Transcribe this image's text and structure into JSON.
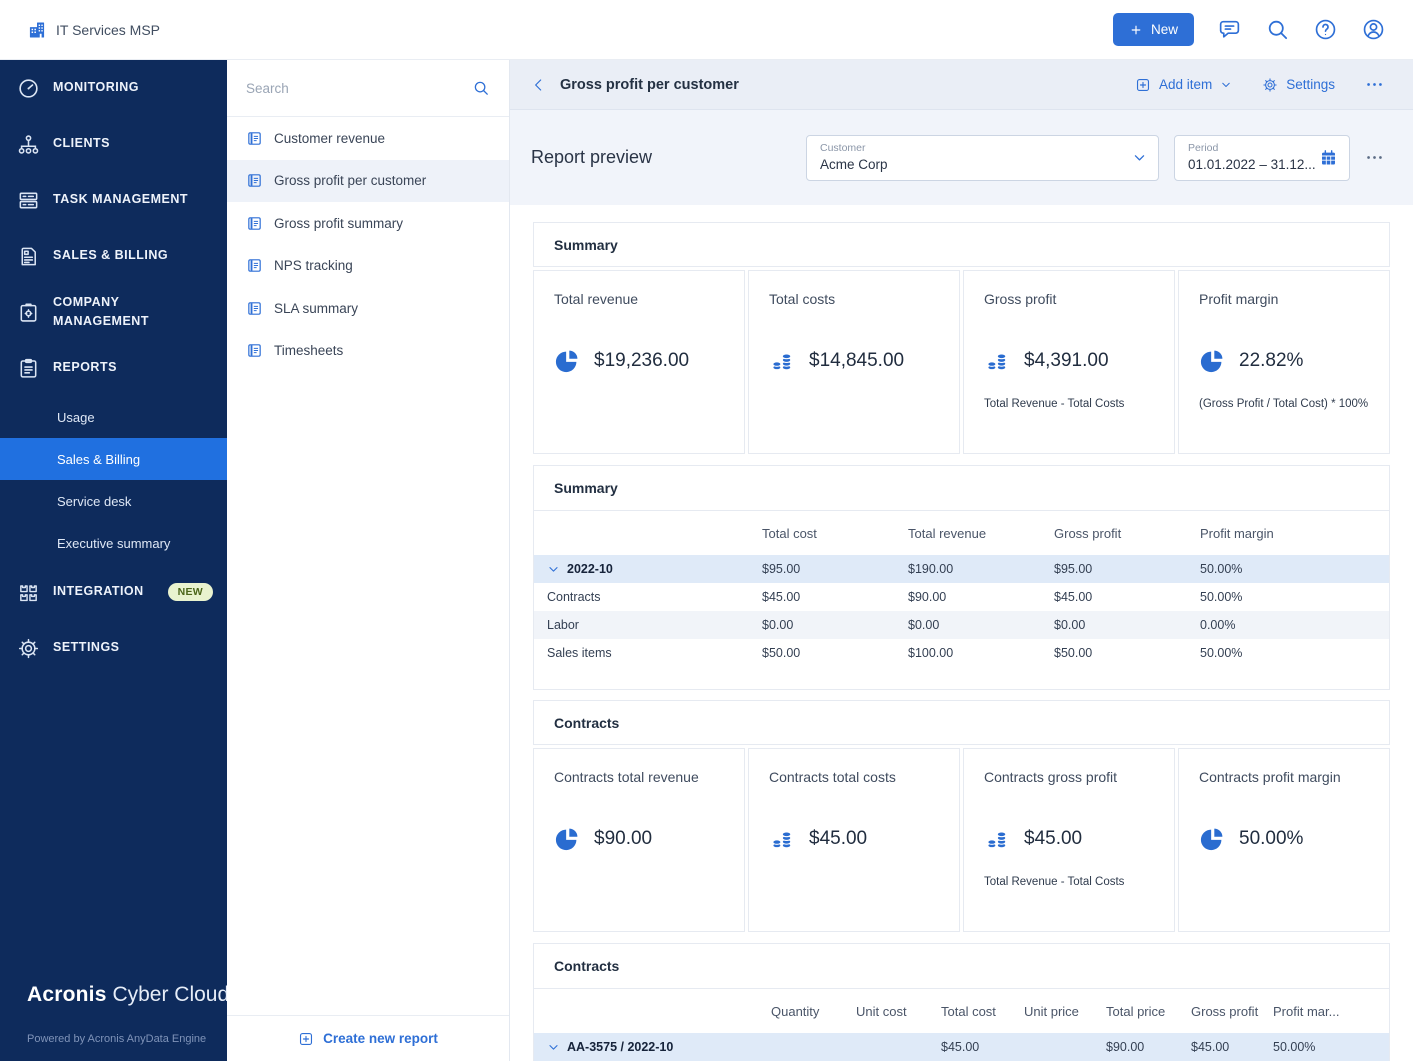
{
  "topbar": {
    "tenant_name": "IT Services MSP",
    "new_button_label": "New"
  },
  "nav": {
    "items": [
      {
        "label": "MONITORING"
      },
      {
        "label": "CLIENTS"
      },
      {
        "label": "TASK MANAGEMENT"
      },
      {
        "label": "SALES & BILLING"
      },
      {
        "label": "COMPANY MANAGEMENT"
      },
      {
        "label": "REPORTS"
      },
      {
        "label": "INTEGRATION",
        "badge": "NEW"
      },
      {
        "label": "SETTINGS"
      }
    ],
    "reports_subitems": [
      {
        "label": "Usage"
      },
      {
        "label": "Sales & Billing",
        "active": true
      },
      {
        "label": "Service desk"
      },
      {
        "label": "Executive summary"
      }
    ],
    "brand": {
      "bold": "Acronis",
      "light": "Cyber Cloud",
      "powered_by": "Powered by Acronis AnyData Engine"
    }
  },
  "reports_panel": {
    "search_placeholder": "Search",
    "items": [
      {
        "label": "Customer revenue"
      },
      {
        "label": "Gross profit per customer",
        "selected": true
      },
      {
        "label": "Gross profit summary"
      },
      {
        "label": "NPS tracking"
      },
      {
        "label": "SLA summary"
      },
      {
        "label": "Timesheets"
      }
    ],
    "create_new_label": "Create new report"
  },
  "header": {
    "title": "Gross profit per customer",
    "add_item_label": "Add item",
    "settings_label": "Settings"
  },
  "preview": {
    "title": "Report preview",
    "customer": {
      "label": "Customer",
      "value": "Acme Corp"
    },
    "period": {
      "label": "Period",
      "value": "01.01.2022 – 31.12..."
    }
  },
  "summary_cards": {
    "title": "Summary",
    "cards": [
      {
        "label": "Total revenue",
        "icon": "pie-chart-icon",
        "value": "$19,236.00",
        "note": ""
      },
      {
        "label": "Total costs",
        "icon": "coins-icon",
        "value": "$14,845.00",
        "note": ""
      },
      {
        "label": "Gross profit",
        "icon": "coins-icon",
        "value": "$4,391.00",
        "note": "Total Revenue - Total Costs"
      },
      {
        "label": "Profit margin",
        "icon": "pie-chart-icon",
        "value": "22.82%",
        "note": "(Gross Profit / Total Cost) * 100%"
      }
    ]
  },
  "summary_table": {
    "title": "Summary",
    "columns": [
      "Total cost",
      "Total revenue",
      "Gross profit",
      "Profit margin"
    ],
    "rows": [
      {
        "label": "2022-10",
        "expanded": true,
        "values": [
          "$95.00",
          "$190.00",
          "$95.00",
          "50.00%"
        ]
      },
      {
        "label": "Contracts",
        "values": [
          "$45.00",
          "$90.00",
          "$45.00",
          "50.00%"
        ]
      },
      {
        "label": "Labor",
        "values": [
          "$0.00",
          "$0.00",
          "$0.00",
          "0.00%"
        ]
      },
      {
        "label": "Sales items",
        "values": [
          "$50.00",
          "$100.00",
          "$50.00",
          "50.00%"
        ]
      }
    ]
  },
  "contracts_cards": {
    "title": "Contracts",
    "cards": [
      {
        "label": "Contracts total revenue",
        "icon": "pie-chart-icon",
        "value": "$90.00",
        "note": ""
      },
      {
        "label": "Contracts total costs",
        "icon": "coins-icon",
        "value": "$45.00",
        "note": ""
      },
      {
        "label": "Contracts gross profit",
        "icon": "coins-icon",
        "value": "$45.00",
        "note": "Total Revenue - Total Costs"
      },
      {
        "label": "Contracts profit margin",
        "icon": "pie-chart-icon",
        "value": "50.00%",
        "note": ""
      }
    ]
  },
  "contracts_table": {
    "title": "Contracts",
    "columns": [
      "Quantity",
      "Unit cost",
      "Total cost",
      "Unit price",
      "Total price",
      "Gross profit",
      "Profit mar..."
    ],
    "rows": [
      {
        "label": "AA-3575 / 2022-10",
        "expanded": true,
        "values": [
          "",
          "",
          "$45.00",
          "",
          "$90.00",
          "$45.00",
          "50.00%"
        ]
      }
    ]
  },
  "colors": {
    "sidebar_bg": "#0e2b5c",
    "active_item_bg": "#2070e0",
    "accent_blue": "#2e6fd6",
    "badge_bg": "#e9f3cf",
    "badge_text": "#4c661a",
    "table_highlight_row": "#dfeaf8",
    "table_alt_row": "#f1f4f9",
    "band_bg": "#eaeef6"
  }
}
